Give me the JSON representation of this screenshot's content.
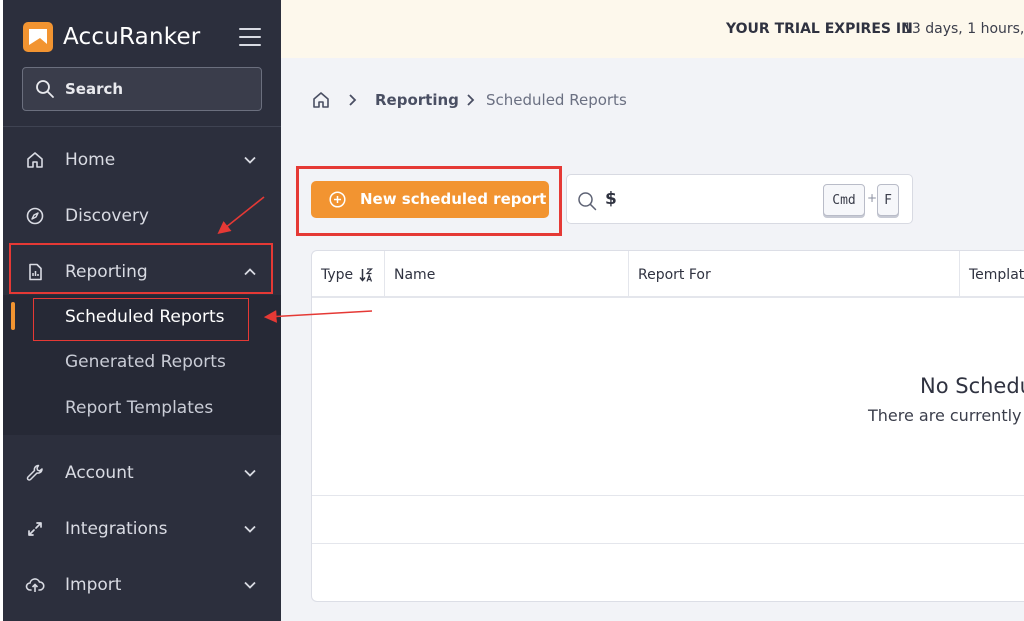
{
  "sidebar": {
    "brand": "AccuRanker",
    "search_label": "Search",
    "nav": [
      {
        "label": "Home"
      },
      {
        "label": "Discovery"
      },
      {
        "label": "Reporting"
      },
      {
        "label": "Account"
      },
      {
        "label": "Integrations"
      },
      {
        "label": "Import"
      }
    ],
    "reporting_sub": [
      {
        "label": "Scheduled Reports"
      },
      {
        "label": "Generated Reports"
      },
      {
        "label": "Report Templates"
      }
    ]
  },
  "header": {
    "trial_label": "YOUR TRIAL EXPIRES IN",
    "trial_value": "13 days, 1 hours, :"
  },
  "breadcrumb": {
    "items": [
      "Reporting",
      "Scheduled Reports"
    ]
  },
  "toolbar": {
    "new_button_label": "New scheduled report",
    "search_value": "$",
    "shortcut_keys": [
      "Cmd",
      "F"
    ],
    "shortcut_plus": "+"
  },
  "table": {
    "columns": [
      "Type",
      "Name",
      "Report For",
      "Templat"
    ],
    "empty_title": "No Schedu",
    "empty_subtitle": "There are currently"
  },
  "colors": {
    "sidebar_bg": "#2c2f3d",
    "accent": "#f29431",
    "annotation_red": "#e53935",
    "trial_bar_bg": "#fdf8ec"
  }
}
